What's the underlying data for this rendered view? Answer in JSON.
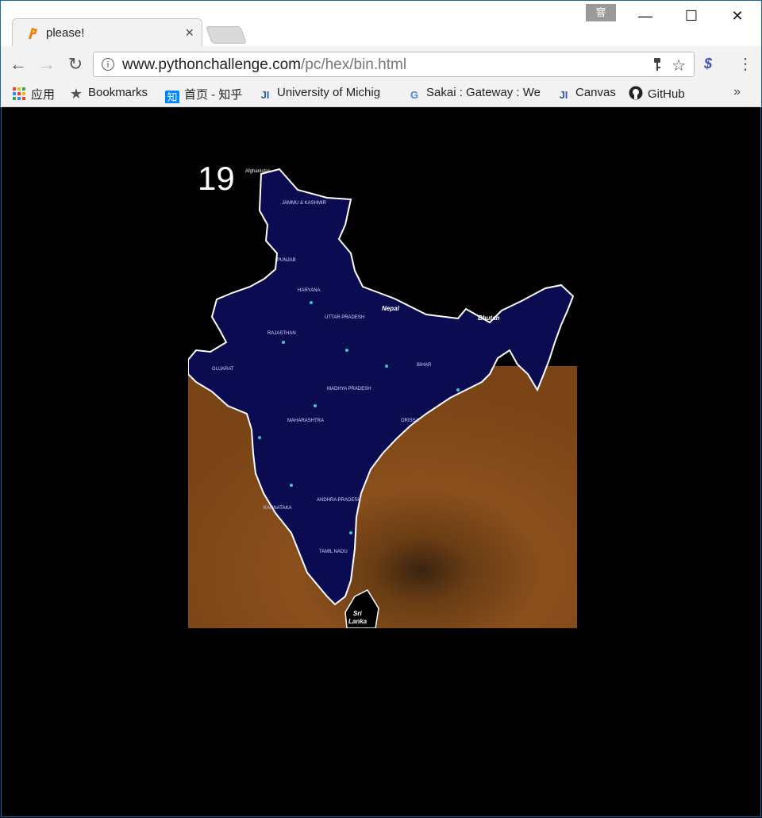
{
  "tab": {
    "title": "please!",
    "close": "×"
  },
  "profile_badge": "窨",
  "window": {
    "minimize": "—",
    "maximize": "☐",
    "close": "✕"
  },
  "nav": {
    "back": "←",
    "forward": "→",
    "reload": "↻"
  },
  "address": {
    "domain": "www.pythonchallenge.com",
    "path": "/pc/hex/bin.html"
  },
  "bookmarks": [
    {
      "icon": "apps-grid-icon",
      "label": "应用"
    },
    {
      "icon": "star-icon",
      "label": "Bookmarks"
    },
    {
      "icon": "zhihu-icon",
      "label": "首页 - 知乎"
    },
    {
      "icon": "ji-icon",
      "label": "University of Michig"
    },
    {
      "icon": "google-icon",
      "label": "Sakai : Gateway : We"
    },
    {
      "icon": "ji-icon",
      "label": "Canvas"
    },
    {
      "icon": "github-icon",
      "label": "GitHub"
    }
  ],
  "more_bookmarks": "»",
  "page": {
    "level_number": "19"
  }
}
